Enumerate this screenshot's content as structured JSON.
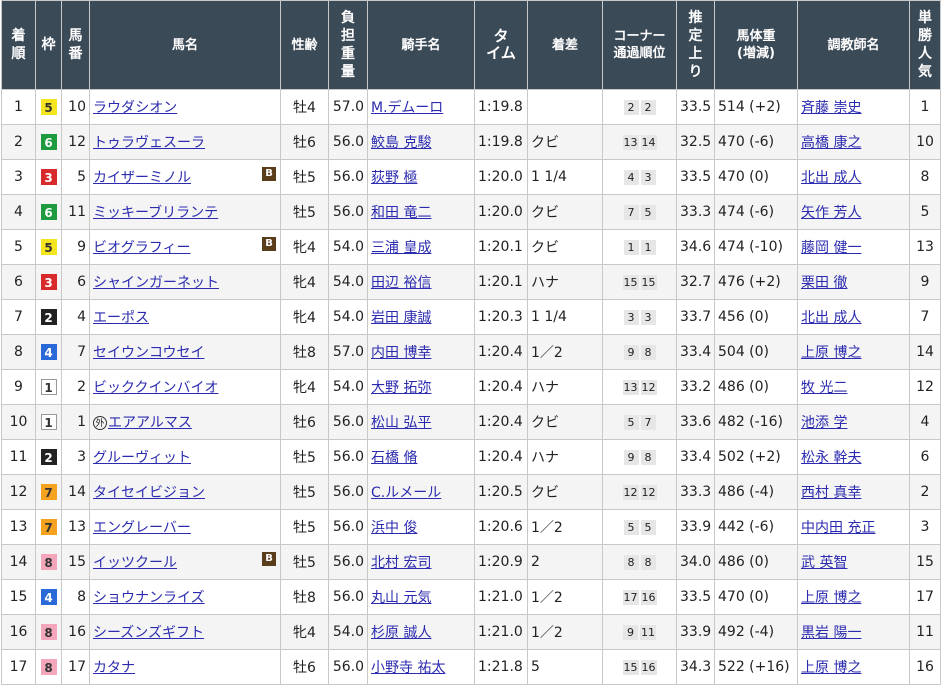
{
  "headers": {
    "rank": [
      "着",
      "順"
    ],
    "waku": "枠",
    "umaban": [
      "馬",
      "番"
    ],
    "name": "馬名",
    "sexage": "性齢",
    "weight": [
      "負",
      "担",
      "重",
      "量"
    ],
    "jockey": "騎手名",
    "time": [
      "タ",
      "イム"
    ],
    "margin": "着差",
    "corner": [
      "コーナー",
      "通過順位"
    ],
    "last3f": [
      "推",
      "定",
      "上",
      "り"
    ],
    "body": [
      "馬体重",
      "(増減)"
    ],
    "trainer": "調教師名",
    "pop": [
      "単",
      "勝",
      "人",
      "気"
    ]
  },
  "icons": {
    "blinker": "B",
    "foreign": "外"
  },
  "rows": [
    {
      "rank": "1",
      "waku": "5",
      "umaban": "10",
      "name": "ラウダシオン",
      "blinker": false,
      "foreign": false,
      "sexage": "牡4",
      "weight": "57.0",
      "jockey": "M.デムーロ",
      "time": "1:19.8",
      "margin": "",
      "c1": "2",
      "c2": "2",
      "last3f": "33.5",
      "body": "514 (+2)",
      "trainer": "斉藤 崇史",
      "pop": "1"
    },
    {
      "rank": "2",
      "waku": "6",
      "umaban": "12",
      "name": "トゥラヴェスーラ",
      "blinker": false,
      "foreign": false,
      "sexage": "牡6",
      "weight": "56.0",
      "jockey": "鮫島 克駿",
      "time": "1:19.8",
      "margin": "クビ",
      "c1": "13",
      "c2": "14",
      "last3f": "32.5",
      "body": "470 (-6)",
      "trainer": "高橋 康之",
      "pop": "10"
    },
    {
      "rank": "3",
      "waku": "3",
      "umaban": "5",
      "name": "カイザーミノル",
      "blinker": true,
      "foreign": false,
      "sexage": "牡5",
      "weight": "56.0",
      "jockey": "荻野 極",
      "time": "1:20.0",
      "margin": "1 1/4",
      "c1": "4",
      "c2": "3",
      "last3f": "33.5",
      "body": "470 (0)",
      "trainer": "北出 成人",
      "pop": "8"
    },
    {
      "rank": "4",
      "waku": "6",
      "umaban": "11",
      "name": "ミッキーブリランテ",
      "blinker": false,
      "foreign": false,
      "sexage": "牡5",
      "weight": "56.0",
      "jockey": "和田 竜二",
      "time": "1:20.0",
      "margin": "クビ",
      "c1": "7",
      "c2": "5",
      "last3f": "33.3",
      "body": "474 (-6)",
      "trainer": "矢作 芳人",
      "pop": "5"
    },
    {
      "rank": "5",
      "waku": "5",
      "umaban": "9",
      "name": "ビオグラフィー",
      "blinker": true,
      "foreign": false,
      "sexage": "牝4",
      "weight": "54.0",
      "jockey": "三浦 皇成",
      "time": "1:20.1",
      "margin": "クビ",
      "c1": "1",
      "c2": "1",
      "last3f": "34.6",
      "body": "474 (-10)",
      "trainer": "藤岡 健一",
      "pop": "13"
    },
    {
      "rank": "6",
      "waku": "3",
      "umaban": "6",
      "name": "シャインガーネット",
      "blinker": false,
      "foreign": false,
      "sexage": "牝4",
      "weight": "54.0",
      "jockey": "田辺 裕信",
      "time": "1:20.1",
      "margin": "ハナ",
      "c1": "15",
      "c2": "15",
      "last3f": "32.7",
      "body": "476 (+2)",
      "trainer": "栗田 徹",
      "pop": "9"
    },
    {
      "rank": "7",
      "waku": "2",
      "umaban": "4",
      "name": "エーポス",
      "blinker": false,
      "foreign": false,
      "sexage": "牝4",
      "weight": "54.0",
      "jockey": "岩田 康誠",
      "time": "1:20.3",
      "margin": "1 1/4",
      "c1": "3",
      "c2": "3",
      "last3f": "33.7",
      "body": "456 (0)",
      "trainer": "北出 成人",
      "pop": "7"
    },
    {
      "rank": "8",
      "waku": "4",
      "umaban": "7",
      "name": "セイウンコウセイ",
      "blinker": false,
      "foreign": false,
      "sexage": "牡8",
      "weight": "57.0",
      "jockey": "内田 博幸",
      "time": "1:20.4",
      "margin": "1／2",
      "c1": "9",
      "c2": "8",
      "last3f": "33.4",
      "body": "504 (0)",
      "trainer": "上原 博之",
      "pop": "14"
    },
    {
      "rank": "9",
      "waku": "1",
      "umaban": "2",
      "name": "ビッククインバイオ",
      "blinker": false,
      "foreign": false,
      "sexage": "牝4",
      "weight": "54.0",
      "jockey": "大野 拓弥",
      "time": "1:20.4",
      "margin": "ハナ",
      "c1": "13",
      "c2": "12",
      "last3f": "33.2",
      "body": "486 (0)",
      "trainer": "牧 光二",
      "pop": "12"
    },
    {
      "rank": "10",
      "waku": "1",
      "umaban": "1",
      "name": "エアアルマス",
      "blinker": false,
      "foreign": true,
      "sexage": "牡6",
      "weight": "56.0",
      "jockey": "松山 弘平",
      "time": "1:20.4",
      "margin": "クビ",
      "c1": "5",
      "c2": "7",
      "last3f": "33.6",
      "body": "482 (-16)",
      "trainer": "池添 学",
      "pop": "4"
    },
    {
      "rank": "11",
      "waku": "2",
      "umaban": "3",
      "name": "グルーヴィット",
      "blinker": false,
      "foreign": false,
      "sexage": "牡5",
      "weight": "56.0",
      "jockey": "石橋 脩",
      "time": "1:20.4",
      "margin": "ハナ",
      "c1": "9",
      "c2": "8",
      "last3f": "33.4",
      "body": "502 (+2)",
      "trainer": "松永 幹夫",
      "pop": "6"
    },
    {
      "rank": "12",
      "waku": "7",
      "umaban": "14",
      "name": "タイセイビジョン",
      "blinker": false,
      "foreign": false,
      "sexage": "牡5",
      "weight": "56.0",
      "jockey": "C.ルメール",
      "time": "1:20.5",
      "margin": "クビ",
      "c1": "12",
      "c2": "12",
      "last3f": "33.3",
      "body": "486 (-4)",
      "trainer": "西村 真幸",
      "pop": "2"
    },
    {
      "rank": "13",
      "waku": "7",
      "umaban": "13",
      "name": "エングレーバー",
      "blinker": false,
      "foreign": false,
      "sexage": "牡5",
      "weight": "56.0",
      "jockey": "浜中 俊",
      "time": "1:20.6",
      "margin": "1／2",
      "c1": "5",
      "c2": "5",
      "last3f": "33.9",
      "body": "442 (-6)",
      "trainer": "中内田 充正",
      "pop": "3"
    },
    {
      "rank": "14",
      "waku": "8",
      "umaban": "15",
      "name": "イッツクール",
      "blinker": true,
      "foreign": false,
      "sexage": "牡5",
      "weight": "56.0",
      "jockey": "北村 宏司",
      "time": "1:20.9",
      "margin": "2",
      "c1": "8",
      "c2": "8",
      "last3f": "34.0",
      "body": "486 (0)",
      "trainer": "武 英智",
      "pop": "15"
    },
    {
      "rank": "15",
      "waku": "4",
      "umaban": "8",
      "name": "ショウナンライズ",
      "blinker": false,
      "foreign": false,
      "sexage": "牡8",
      "weight": "56.0",
      "jockey": "丸山 元気",
      "time": "1:21.0",
      "margin": "1／2",
      "c1": "17",
      "c2": "16",
      "last3f": "33.5",
      "body": "470 (0)",
      "trainer": "上原 博之",
      "pop": "17"
    },
    {
      "rank": "16",
      "waku": "8",
      "umaban": "16",
      "name": "シーズンズギフト",
      "blinker": false,
      "foreign": false,
      "sexage": "牝4",
      "weight": "54.0",
      "jockey": "杉原 誠人",
      "time": "1:21.0",
      "margin": "1／2",
      "c1": "9",
      "c2": "11",
      "last3f": "33.9",
      "body": "492 (-4)",
      "trainer": "黒岩 陽一",
      "pop": "11"
    },
    {
      "rank": "17",
      "waku": "8",
      "umaban": "17",
      "name": "カタナ",
      "blinker": false,
      "foreign": false,
      "sexage": "牡6",
      "weight": "56.0",
      "jockey": "小野寺 祐太",
      "time": "1:21.8",
      "margin": "5",
      "c1": "15",
      "c2": "16",
      "last3f": "34.3",
      "body": "522 (+16)",
      "trainer": "上原 博之",
      "pop": "16"
    }
  ]
}
